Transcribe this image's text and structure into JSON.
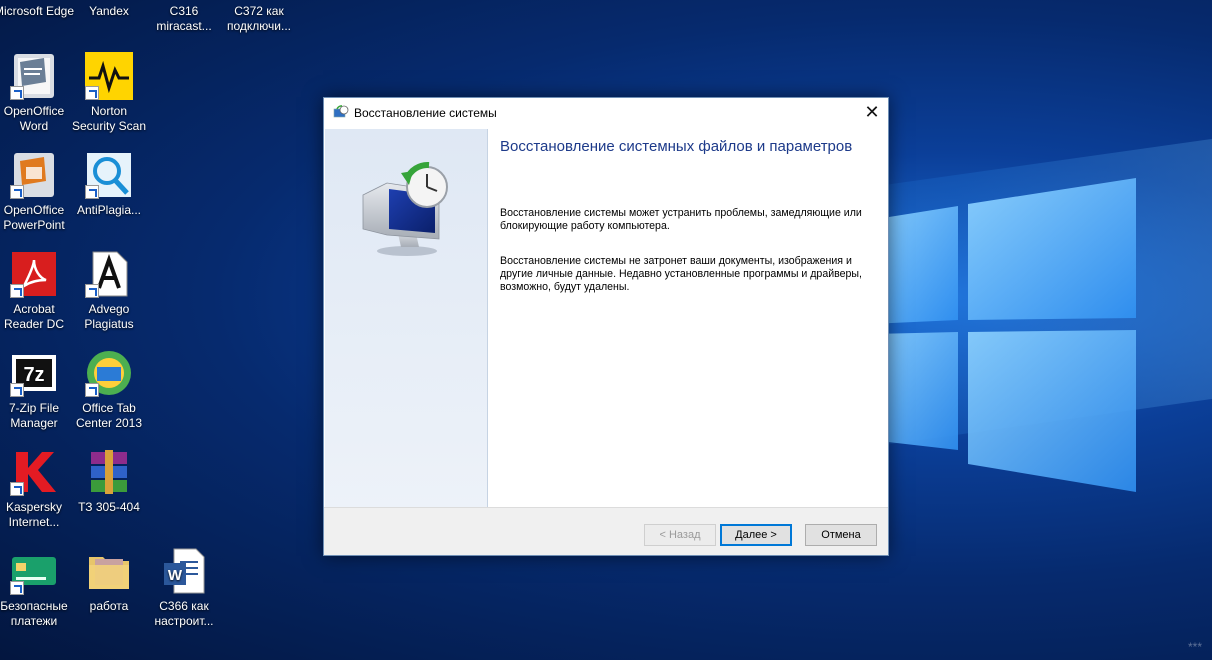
{
  "desktop": {
    "icons": [
      {
        "label": "Microsoft Edge",
        "icon": "edge-icon"
      },
      {
        "label": "Yandex",
        "icon": "yandex-icon"
      },
      {
        "label": "С316 miracast...",
        "icon": "document-icon"
      },
      {
        "label": "С372 как подключи...",
        "icon": "document-icon"
      },
      {
        "label": "OpenOffice Word",
        "icon": "openoffice-writer-icon"
      },
      {
        "label": "Norton Security Scan",
        "icon": "norton-icon"
      },
      {
        "label": "OpenOffice PowerPoint",
        "icon": "openoffice-impress-icon"
      },
      {
        "label": "AntiPlagia...",
        "icon": "antiplagiat-icon"
      },
      {
        "label": "Acrobat Reader DC",
        "icon": "acrobat-icon"
      },
      {
        "label": "Advego Plagiatus",
        "icon": "advego-icon"
      },
      {
        "label": "7-Zip File Manager",
        "icon": "7zip-icon"
      },
      {
        "label": "Office Tab Center 2013",
        "icon": "office-tab-icon"
      },
      {
        "label": "Kaspersky Internet...",
        "icon": "kaspersky-icon"
      },
      {
        "label": "ТЗ 305-404",
        "icon": "winrar-icon"
      },
      {
        "label": "Безопасные платежи",
        "icon": "safe-payments-icon"
      },
      {
        "label": "работа",
        "icon": "folder-icon"
      },
      {
        "label": "С366 как настроит...",
        "icon": "word-document-icon"
      }
    ],
    "watermark": "***"
  },
  "dialog": {
    "title": "Восстановление системы",
    "close_glyph": "✕",
    "heading": "Восстановление системных файлов и параметров",
    "paragraph1": "Восстановление системы может устранить проблемы, замедляющие или блокирующие работу компьютера.",
    "paragraph2": "Восстановление системы не затронет ваши документы, изображения и другие личные данные. Недавно установленные программы и драйверы, возможно, будут удалены.",
    "buttons": {
      "back": "< Назад",
      "next": "Далее >",
      "cancel": "Отмена"
    }
  },
  "colors": {
    "accent": "#0078d7",
    "heading": "#1d3a8a"
  }
}
